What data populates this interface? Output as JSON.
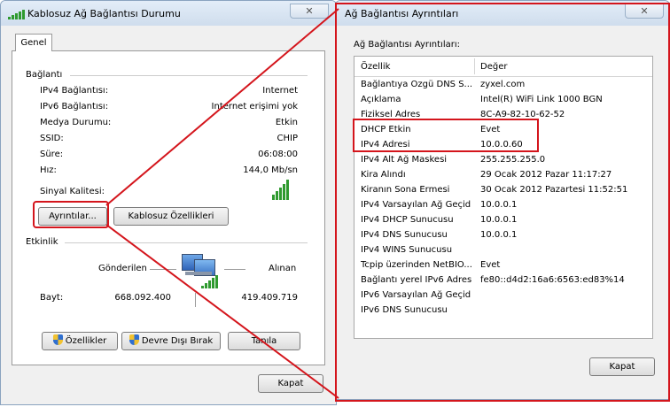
{
  "status_window": {
    "title": "Kablosuz Ağ Bağlantısı Durumu",
    "close_glyph": "✕",
    "tab_label": "Genel",
    "connection": {
      "header": "Bağlantı",
      "rows": [
        {
          "label": "IPv4 Bağlantısı:",
          "value": "Internet"
        },
        {
          "label": "IPv6 Bağlantısı:",
          "value": "Internet erişimi yok"
        },
        {
          "label": "Medya Durumu:",
          "value": "Etkin"
        },
        {
          "label": "SSID:",
          "value": "CHIP"
        },
        {
          "label": "Süre:",
          "value": "06:08:00"
        },
        {
          "label": "Hız:",
          "value": "144,0 Mb/sn"
        }
      ],
      "signal_label": "Sinyal Kalitesi:",
      "signal_bars_lit": 5,
      "signal_bars_total": 5
    },
    "details_button": "Ayrıntılar...",
    "wireless_props_button": "Kablosuz Özellikleri",
    "activity": {
      "header": "Etkinlik",
      "sent_label": "Gönderilen",
      "received_label": "Alınan",
      "bytes_label": "Bayt:",
      "bytes_sent": "668.092.400",
      "bytes_received": "419.409.719"
    },
    "properties_button": "Özellikler",
    "disable_button": "Devre Dışı Bırak",
    "diagnose_button": "Tanıla",
    "close_button": "Kapat"
  },
  "details_window": {
    "title": "Ağ Bağlantısı Ayrıntıları",
    "close_glyph": "✕",
    "section_label": "Ağ Bağlantısı Ayrıntıları:",
    "columns": {
      "property": "Özellik",
      "value": "Değer"
    },
    "rows": [
      {
        "property": "Bağlantıya Özgü DNS S...",
        "value": "zyxel.com"
      },
      {
        "property": "Açıklama",
        "value": "Intel(R) WiFi Link 1000 BGN"
      },
      {
        "property": "Fiziksel Adres",
        "value": "8C-A9-82-10-62-52"
      },
      {
        "property": "DHCP Etkin",
        "value": "Evet"
      },
      {
        "property": "IPv4 Adresi",
        "value": "10.0.0.60"
      },
      {
        "property": "IPv4 Alt Ağ Maskesi",
        "value": "255.255.255.0"
      },
      {
        "property": "Kira Alındı",
        "value": "29 Ocak 2012 Pazar 11:17:27"
      },
      {
        "property": "Kiranın Sona Ermesi",
        "value": "30 Ocak 2012 Pazartesi 11:52:51"
      },
      {
        "property": "IPv4 Varsayılan Ağ Geçidi",
        "value": "10.0.0.1"
      },
      {
        "property": "IPv4 DHCP Sunucusu",
        "value": "10.0.0.1"
      },
      {
        "property": "IPv4 DNS Sunucusu",
        "value": "10.0.0.1"
      },
      {
        "property": "IPv4 WINS Sunucusu",
        "value": ""
      },
      {
        "property": "Tcpip üzerinden NetBIO...",
        "value": "Evet"
      },
      {
        "property": "Bağlantı yerel IPv6 Adresi",
        "value": "fe80::d4d2:16a6:6563:ed83%14"
      },
      {
        "property": "IPv6 Varsayılan Ağ Geçidi",
        "value": ""
      },
      {
        "property": "IPv6 DNS Sunucusu",
        "value": ""
      }
    ],
    "close_button": "Kapat"
  },
  "colors": {
    "annotation_red": "#d4151c",
    "signal_green": "#2f9a2f"
  }
}
